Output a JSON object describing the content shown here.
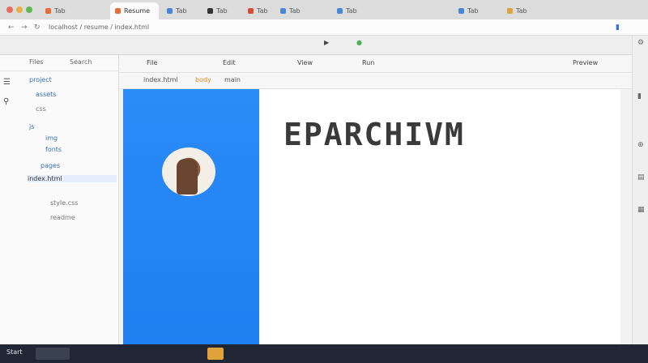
{
  "colors": {
    "panel_blue": "#1f7ff0",
    "accent_orange": "#e08a2a",
    "taskbar": "#202633"
  },
  "browser": {
    "tabs": [
      {
        "label": "Tab",
        "dot": "#e86b3a"
      },
      {
        "label": "Resume",
        "dot": "#e86b3a"
      },
      {
        "label": "Tab",
        "dot": "#4a86d8"
      },
      {
        "label": "Tab",
        "dot": "#333333"
      },
      {
        "label": "Tab",
        "dot": "#d64a3a"
      },
      {
        "label": "Tab",
        "dot": "#4a86d8"
      },
      {
        "label": "Tab",
        "dot": "#4a86d8"
      },
      {
        "label": "Tab",
        "dot": "#4a86d8"
      },
      {
        "label": "Tab",
        "dot": "#e0a23a"
      }
    ],
    "url": "localhost / resume / index.html",
    "back_icon": "back-arrow-icon",
    "forward_icon": "forward-arrow-icon"
  },
  "sidebar": {
    "head": [
      "Files",
      "Search"
    ],
    "items": [
      {
        "label": "project",
        "dim": false
      },
      {
        "label": "assets",
        "dim": false
      },
      {
        "label": "css",
        "dim": true
      },
      {
        "label": "js",
        "dim": false
      },
      {
        "label": "img",
        "dim": false
      },
      {
        "label": "fonts",
        "dim": false
      },
      {
        "label": "pages",
        "dim": false
      },
      {
        "label": "index.html",
        "dim": false
      },
      {
        "label": "style.css",
        "dim": true
      },
      {
        "label": "readme",
        "dim": true
      }
    ]
  },
  "toolbar": {
    "row1": [
      "File",
      "Edit",
      "View",
      "Run",
      "Preview"
    ],
    "crumbs": [
      "index.html",
      "body",
      "main"
    ]
  },
  "preview": {
    "title": "EPARCHIVM",
    "subtitle_left": "",
    "subtitle_right": "",
    "name": "",
    "panel_lines": [],
    "paragraphs": []
  },
  "taskbar": {
    "start": "Start",
    "clock": ""
  }
}
